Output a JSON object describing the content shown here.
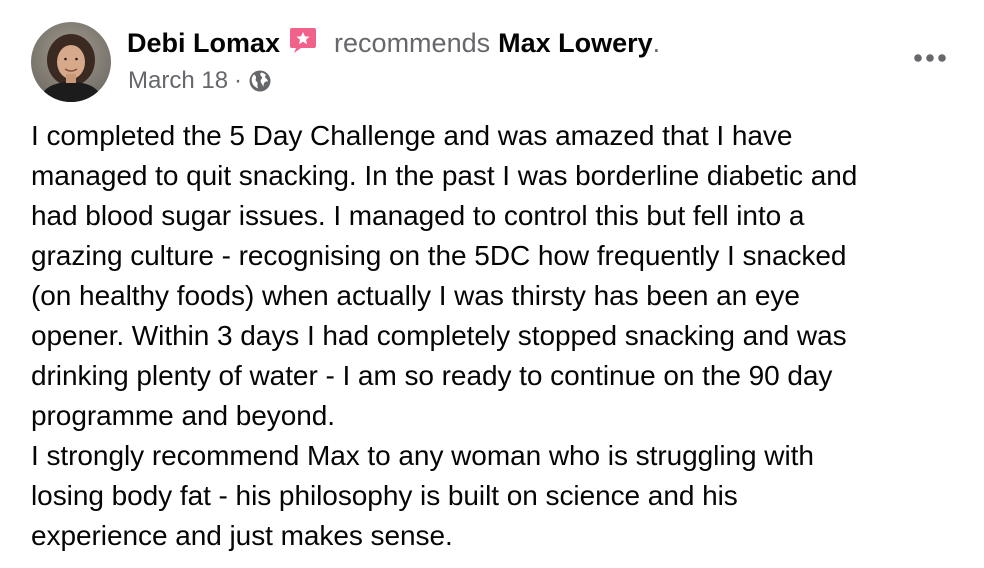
{
  "post": {
    "author": "Debi Lomax",
    "action": "recommends",
    "page": "Max Lowery",
    "period": ".",
    "date": "March 18",
    "separator": "·",
    "privacy_icon": "globe-icon",
    "badge_icon": "recommendation-star-icon",
    "menu_icon": "more-options-icon",
    "colors": {
      "text": "#050505",
      "secondary": "#65676b",
      "badge": "#f0628a"
    },
    "body_lines": [
      "I completed the 5 Day Challenge and was amazed that I have",
      "managed to quit snacking.  In the past I was borderline diabetic and",
      "had blood sugar issues.  I managed to control this but fell into a",
      "grazing culture - recognising on the 5DC how frequently I snacked",
      "(on healthy foods) when actually I was thirsty has been an eye",
      "opener.  Within 3 days I had completely stopped snacking and was",
      "drinking plenty of water - I am so ready to continue on the 90 day",
      "programme and beyond.",
      "I strongly recommend Max to any woman who is struggling with",
      "losing body fat - his philosophy is built on science and his",
      "experience and just makes sense."
    ]
  }
}
